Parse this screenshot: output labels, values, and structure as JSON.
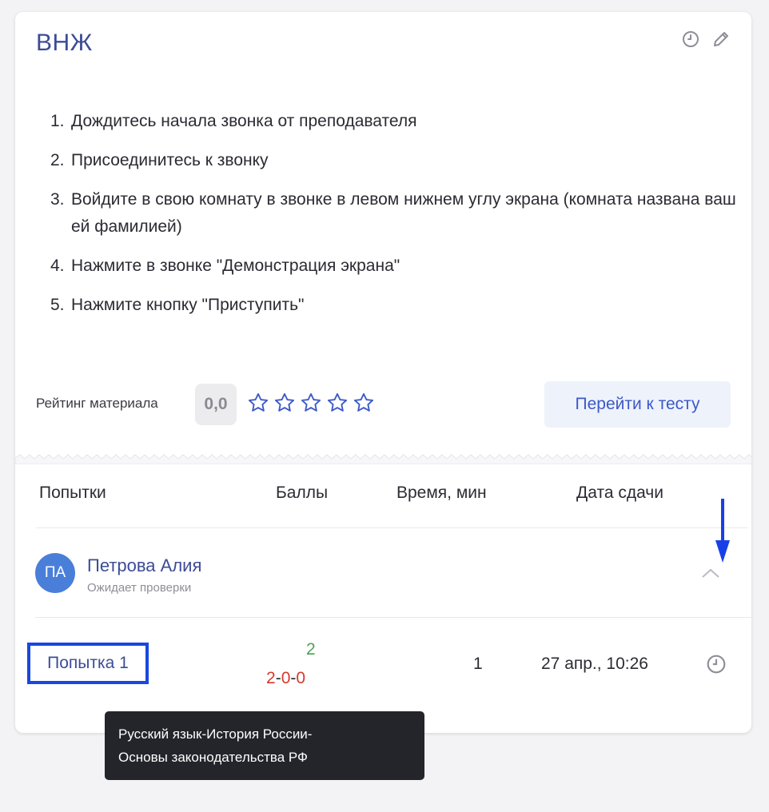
{
  "card": {
    "title": "ВНЖ"
  },
  "instructions": [
    {
      "num": "1.",
      "text": "Дождитесь начала звонка от преподавателя"
    },
    {
      "num": "2.",
      "text": "Присоединитесь к звонку"
    },
    {
      "num": "3.",
      "text": "Войдите в свою комнату в звонке в левом нижнем углу экрана (комната названа вашей фамилией)"
    },
    {
      "num": "4.",
      "text": "Нажмите в звонке \"Демонстрация экрана\""
    },
    {
      "num": "5.",
      "text": "Нажмите кнопку \"Приступить\""
    }
  ],
  "rating": {
    "label": "Рейтинг материала",
    "value": "0,0",
    "stars_filled": 0,
    "stars_total": 5
  },
  "go_button": "Перейти к тесту",
  "table": {
    "headers": {
      "attempts": "Попытки",
      "points": "Баллы",
      "time": "Время, мин",
      "date": "Дата сдачи"
    }
  },
  "student": {
    "initials": "ПА",
    "name": "Петрова Алия",
    "status": "Ожидает проверки"
  },
  "attempt": {
    "label": "Попытка 1",
    "score_total": "2",
    "score_parts": [
      "2",
      "0",
      "0"
    ],
    "score_sep": "-",
    "time": "1",
    "date": "27 апр., 10:26"
  },
  "tooltip": {
    "line1": "Русский язык-История России-",
    "line2": "Основы законодательства РФ"
  },
  "colors": {
    "accent": "#3c4c96",
    "link_button": "#3c59c8",
    "score_good": "#4ca155",
    "score_bad": "#d8392c",
    "highlight": "#1848e0"
  }
}
